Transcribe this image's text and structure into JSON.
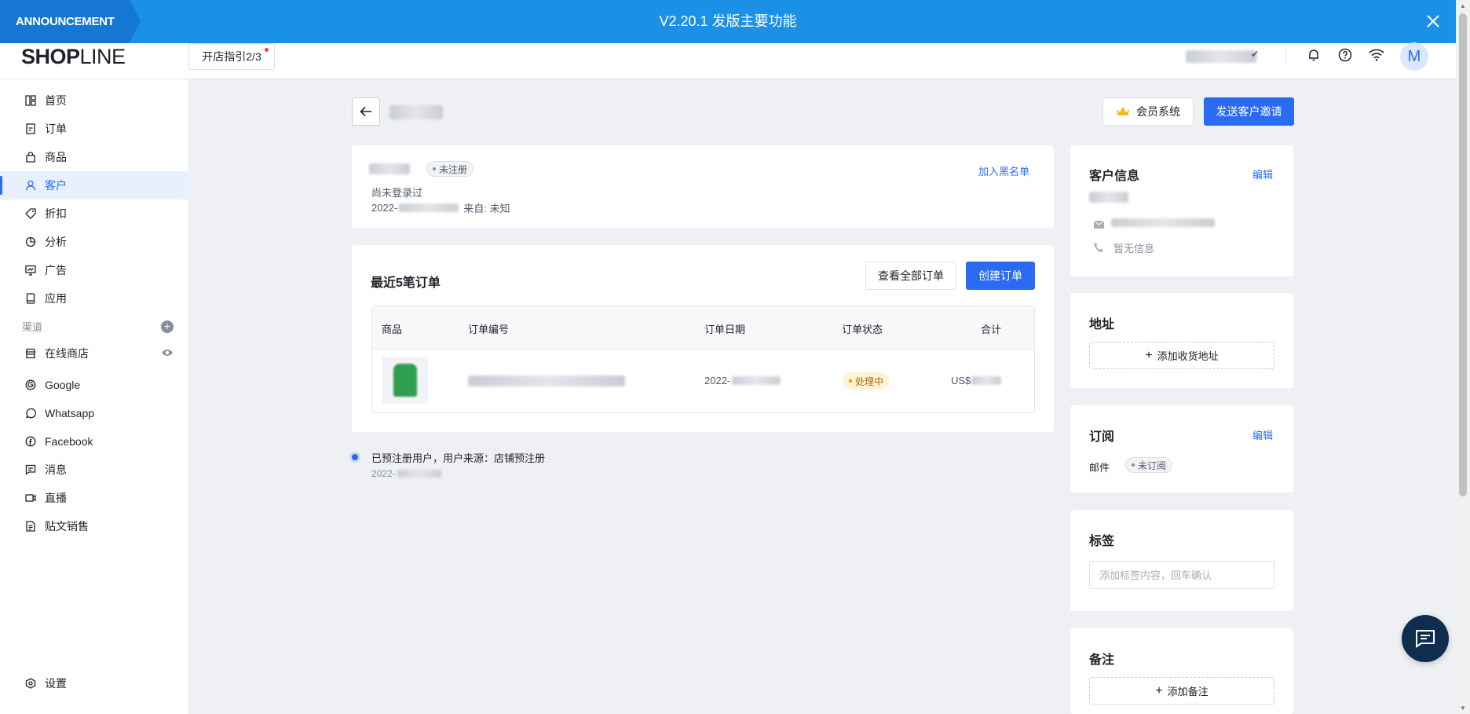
{
  "announcement": {
    "tag": "ANNOUNCEMENT",
    "title": "V2.20.1 发版主要功能"
  },
  "header": {
    "logo_bold": "SHOP",
    "logo_thin": "LINE",
    "guide_label": "开店指引2/3",
    "avatar_letter": "M"
  },
  "sidebar": {
    "items": [
      {
        "label": "首页",
        "icon": "dashboard-icon"
      },
      {
        "label": "订单",
        "icon": "order-icon"
      },
      {
        "label": "商品",
        "icon": "product-bag-icon"
      },
      {
        "label": "客户",
        "icon": "customer-icon"
      },
      {
        "label": "折扣",
        "icon": "discount-tag-icon"
      },
      {
        "label": "分析",
        "icon": "analytics-pie-icon"
      },
      {
        "label": "广告",
        "icon": "ads-monitor-icon"
      },
      {
        "label": "应用",
        "icon": "apps-icon"
      }
    ],
    "channels_label": "渠道",
    "channels": [
      {
        "label": "在线商店",
        "icon": "online-store-icon"
      },
      {
        "label": "Google",
        "icon": "google-icon"
      },
      {
        "label": "Whatsapp",
        "icon": "whatsapp-icon"
      },
      {
        "label": "Facebook",
        "icon": "facebook-icon"
      },
      {
        "label": "消息",
        "icon": "message-icon"
      },
      {
        "label": "直播",
        "icon": "live-video-icon"
      },
      {
        "label": "贴文销售",
        "icon": "post-sales-icon"
      }
    ],
    "settings_label": "设置"
  },
  "actions": {
    "membership_label": "会员系统",
    "invite_label": "发送客户邀请"
  },
  "profile": {
    "status_badge": "未注册",
    "blacklist_link": "加入黑名单",
    "login_status": "尚未登录过",
    "date_prefix": "2022-",
    "source": "来自: 未知"
  },
  "orders": {
    "title": "最近5笔订单",
    "view_all_label": "查看全部订单",
    "create_label": "创建订单",
    "columns": [
      "商品",
      "订单编号",
      "订单日期",
      "订单状态",
      "合计"
    ],
    "row": {
      "date_prefix": "2022-",
      "status": "处理中",
      "total_prefix": "US$"
    }
  },
  "timeline": {
    "text": "已预注册用户，用户来源：店铺预注册",
    "date_prefix": "2022-"
  },
  "customer_info": {
    "title": "客户信息",
    "edit_label": "编辑",
    "phone": "暂无信息"
  },
  "address": {
    "title": "地址",
    "add_label": "添加收货地址"
  },
  "subscription": {
    "title": "订阅",
    "edit_label": "编辑",
    "email_label": "邮件",
    "email_status": "未订阅"
  },
  "tags": {
    "title": "标签",
    "placeholder": "添加标签内容，回车确认"
  },
  "notes": {
    "title": "备注",
    "add_label": "添加备注"
  },
  "colors": {
    "primary": "#2b6bf3",
    "announcement": "#1a90e6",
    "chat_fab": "#0e2d4f"
  }
}
